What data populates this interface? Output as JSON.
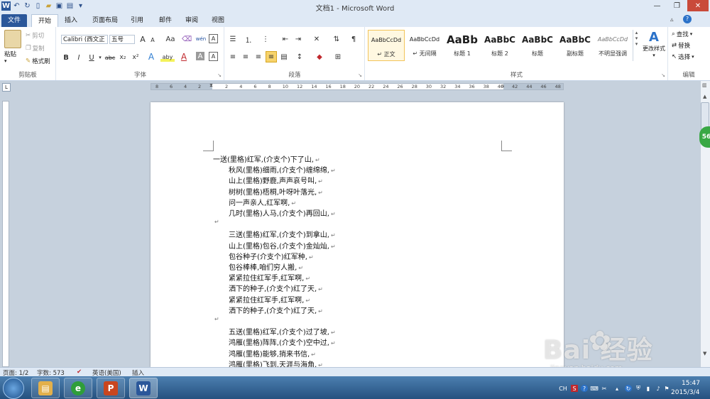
{
  "window": {
    "title": "文档1 - Microsoft Word",
    "app_icon": "W"
  },
  "tabs": [
    "文件",
    "开始",
    "插入",
    "页面布局",
    "引用",
    "邮件",
    "审阅",
    "视图"
  ],
  "ribbon": {
    "clipboard": {
      "paste": "粘贴",
      "cut": "剪切",
      "copy": "复制",
      "format_painter": "格式刷",
      "label": "剪贴板"
    },
    "font": {
      "font_name": "Calibri (西文正",
      "font_size": "五号",
      "grow": "A",
      "shrink": "A",
      "case": "Aa",
      "wen": "wén",
      "bold": "B",
      "italic": "I",
      "underline": "U",
      "strike": "abc",
      "subscript": "x₂",
      "superscript": "x²",
      "text_effect": "A",
      "highlight": "aby",
      "font_color": "A",
      "char_shade": "A",
      "label": "字体"
    },
    "paragraph": {
      "label": "段落"
    },
    "styles": {
      "items": [
        {
          "sample": "AaBbCcDd",
          "name": "↵ 正文"
        },
        {
          "sample": "AaBbCcDd",
          "name": "↵ 无间隔"
        },
        {
          "sample": "AaBb",
          "name": "标题 1"
        },
        {
          "sample": "AaBbC",
          "name": "标题 2"
        },
        {
          "sample": "AaBbC",
          "name": "标题"
        },
        {
          "sample": "AaBbC",
          "name": "副标题"
        },
        {
          "sample": "AaBbCcDd",
          "name": "不明显强调"
        }
      ],
      "change_styles": "更改样式",
      "label": "样式"
    },
    "editing": {
      "find": "查找",
      "replace": "替换",
      "select": "选择",
      "label": "编辑"
    }
  },
  "ruler": {
    "h_left_ticks": [
      "8",
      "6",
      "4",
      "2"
    ],
    "h_right_ticks": [
      "2",
      "4",
      "6",
      "8",
      "10",
      "12",
      "14",
      "16",
      "18",
      "20",
      "22",
      "24",
      "26",
      "28",
      "30",
      "32",
      "34",
      "36",
      "38",
      "40",
      "42",
      "44",
      "46",
      "48"
    ]
  },
  "document": {
    "first_line": "一送(里格)红军,(介支个)下了山,",
    "stanzas": [
      [
        "秋风(里格)细雨,(介支个)缠绵绵,",
        "山上(里格)野鹿,声声哀号叫,",
        "树树(里格)梧桐,叶呀叶落光,",
        "问一声亲人,红军啊,",
        "几时(里格)人马,(介支个)再回山,"
      ],
      [
        "三送(里格)红军,(介支个)到拿山,",
        "山上(里格)包谷,(介支个)金灿灿,",
        "包谷种子(介支个)红军种,",
        "包谷棒棒,咱们穷人搬,",
        "紧紧拉住红军手,红军啊,",
        "洒下的种子,(介支个)红了天,",
        "紧紧拉住红军手,红军啊,",
        "洒下的种子,(介支个)红了天,"
      ],
      [
        "五送(里格)红军,(介支个)过了坡,",
        "鸿雁(里格)阵阵,(介支个)空中过,",
        "鸿雁(里格)能够,捎来书信,",
        "鸿雁(里格)飞到,天涯与海角,"
      ]
    ],
    "paragraph_mark": "↵"
  },
  "side_badge": "56",
  "status": {
    "page": "页面: 1/2",
    "words": "字数: 573",
    "language": "英语(美国)",
    "insert": "插入"
  },
  "watermark": {
    "brand": "Bai  经验",
    "url": "jingyan.baidu.com"
  },
  "taskbar": {
    "apps": [
      {
        "name": "explorer",
        "glyph": "▤",
        "color": "#e3b04b"
      },
      {
        "name": "browser",
        "glyph": "e",
        "color": "#2f9e3a"
      },
      {
        "name": "powerpoint",
        "glyph": "P",
        "color": "#c9461f"
      },
      {
        "name": "word",
        "glyph": "W",
        "color": "#2b579a"
      }
    ],
    "tray_lang": "CH",
    "clock_time": "15:47",
    "clock_date": "2015/3/4"
  }
}
